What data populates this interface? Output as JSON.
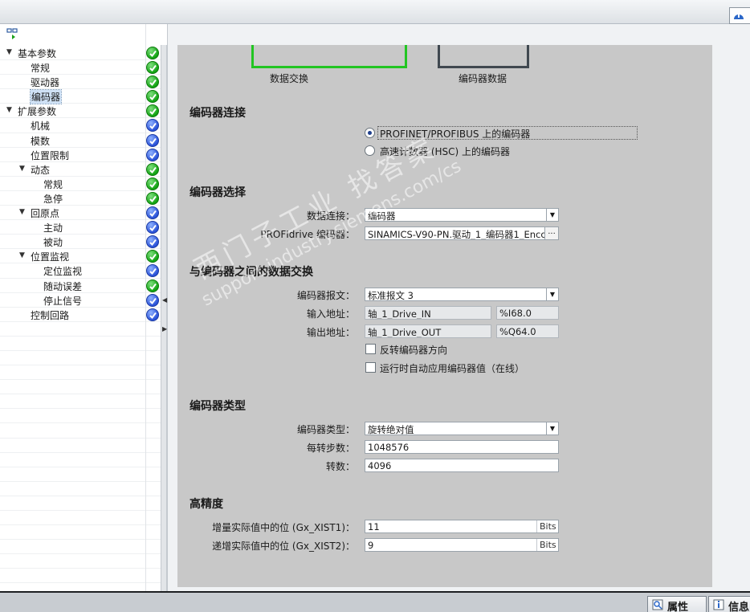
{
  "tree": {
    "items": [
      {
        "label": "基本参数",
        "level": 0,
        "expanded": true,
        "status": "ok"
      },
      {
        "label": "常规",
        "level": 1,
        "status": "ok"
      },
      {
        "label": "驱动器",
        "level": 1,
        "status": "ok"
      },
      {
        "label": "编码器",
        "level": 1,
        "status": "ok",
        "selected": true
      },
      {
        "label": "扩展参数",
        "level": 0,
        "expanded": true,
        "status": "ok"
      },
      {
        "label": "机械",
        "level": 1,
        "status": "cfg"
      },
      {
        "label": "模数",
        "level": 1,
        "status": "cfg"
      },
      {
        "label": "位置限制",
        "level": 1,
        "status": "cfg"
      },
      {
        "label": "动态",
        "level": 1,
        "expanded": true,
        "status": "ok"
      },
      {
        "label": "常规",
        "level": 2,
        "status": "ok"
      },
      {
        "label": "急停",
        "level": 2,
        "status": "ok"
      },
      {
        "label": "回原点",
        "level": 1,
        "expanded": true,
        "status": "cfg"
      },
      {
        "label": "主动",
        "level": 2,
        "status": "cfg"
      },
      {
        "label": "被动",
        "level": 2,
        "status": "cfg"
      },
      {
        "label": "位置监视",
        "level": 1,
        "expanded": true,
        "status": "ok"
      },
      {
        "label": "定位监视",
        "level": 2,
        "status": "cfg"
      },
      {
        "label": "随动误差",
        "level": 2,
        "status": "ok"
      },
      {
        "label": "停止信号",
        "level": 2,
        "status": "cfg"
      },
      {
        "label": "控制回路",
        "level": 1,
        "status": "cfg"
      }
    ]
  },
  "diagram": {
    "data_exchange_caption": "数据交换",
    "encoder_data_caption": "编码器数据",
    "left_color": "#22c522",
    "right_color": "#404850"
  },
  "sections": {
    "connection": {
      "title": "编码器连接",
      "option_profinet": "PROFINET/PROFIBUS 上的编码器",
      "option_hsc": "高速计数器 (HSC) 上的编码器",
      "selected": "profinet"
    },
    "selection": {
      "title": "编码器选择",
      "data_connection_label": "数据连接：",
      "data_connection_value": "编码器",
      "profidrive_label": "PROFIdrive 编码器：",
      "profidrive_value": "SINAMICS-V90-PN.驱动_1_编码器1_Encod"
    },
    "exchange": {
      "title": "与编码器之间的数据交换",
      "telegram_label": "编码器报文：",
      "telegram_value": "标准报文 3",
      "input_label": "输入地址：",
      "input_name": "轴_1_Drive_IN",
      "input_addr": "%I68.0",
      "output_label": "输出地址：",
      "output_name": "轴_1_Drive_OUT",
      "output_addr": "%Q64.0",
      "reverse_label": "反转编码器方向",
      "autoapply_label": "运行时自动应用编码器值（在线）"
    },
    "type": {
      "title": "编码器类型",
      "type_label": "编码器类型：",
      "type_value": "旋转绝对值",
      "steps_label": "每转步数：",
      "steps_value": "1048576",
      "revs_label": "转数：",
      "revs_value": "4096"
    },
    "precision": {
      "title": "高精度",
      "incr_label": "增量实际值中的位 (Gx_XIST1)：",
      "incr_value": "11",
      "abs_label": "递增实际值中的位 (Gx_XIST2)：",
      "abs_value": "9",
      "unit": "Bits"
    }
  },
  "watermark": {
    "line1": "西门子工业  找答案",
    "line2": "support.industry.siemens.com/cs"
  },
  "bottom_tabs": {
    "properties": "属性",
    "info": "信息"
  }
}
